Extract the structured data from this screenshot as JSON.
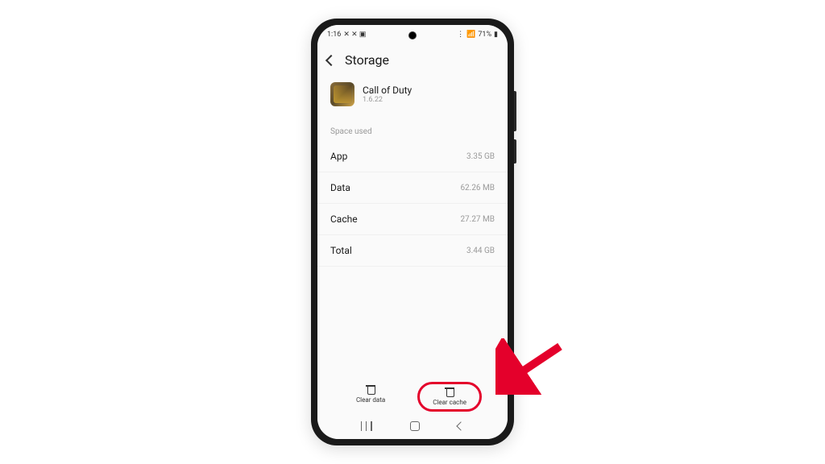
{
  "status": {
    "time": "1:16",
    "battery": "71%"
  },
  "header": {
    "title": "Storage"
  },
  "app": {
    "name": "Call of Duty",
    "version": "1.6.22"
  },
  "section_label": "Space used",
  "rows": [
    {
      "label": "App",
      "value": "3.35 GB"
    },
    {
      "label": "Data",
      "value": "62.26 MB"
    },
    {
      "label": "Cache",
      "value": "27.27 MB"
    },
    {
      "label": "Total",
      "value": "3.44 GB"
    }
  ],
  "actions": {
    "clear_data": "Clear data",
    "clear_cache": "Clear cache"
  },
  "annotation": {
    "arrow_color": "#e4002b"
  }
}
